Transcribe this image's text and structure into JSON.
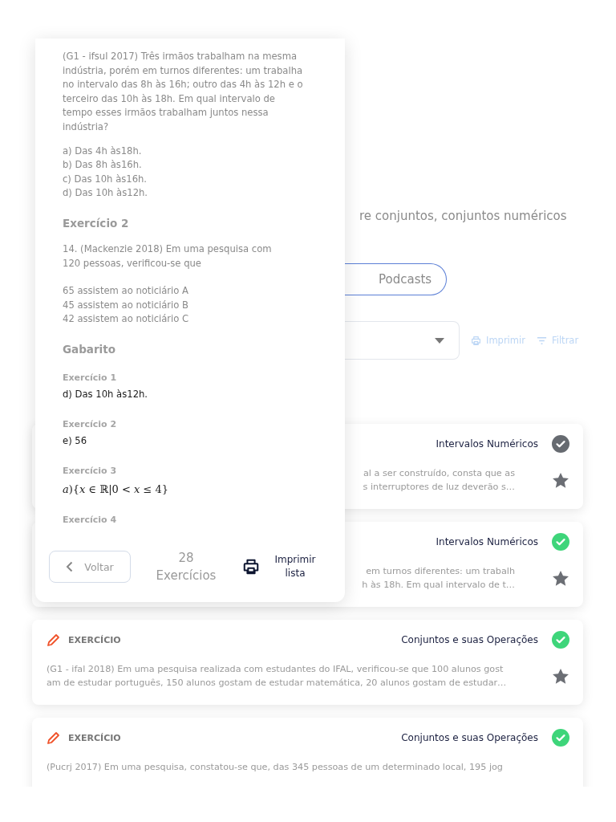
{
  "page": {
    "intro": "re conjuntos, conjuntos numéricos",
    "pill": "Podcasts",
    "actions": [
      {
        "kind": "print",
        "label": "Imprimir"
      },
      {
        "kind": "filter",
        "label": "Filtrar"
      }
    ],
    "cards": [
      {
        "topic": "Intervalos Numéricos",
        "solved": false,
        "lines": [
          "al a ser construído, consta que as",
          "s interruptores de luz deverão s…"
        ]
      },
      {
        "topic": "Intervalos Numéricos",
        "solved": true,
        "lines": [
          "em turnos diferentes: um trabalh",
          "h às 18h. Em qual intervalo de t…"
        ]
      },
      {
        "label": "EXERCÍCIO",
        "topic": "Conjuntos e suas Operações",
        "solved": true,
        "lines": [
          "(G1 - ifal 2018)  Em uma pesquisa realizada com estudantes do IFAL, verificou-se que 100 alunos gost",
          "am de estudar português, 150 alunos gostam de estudar matemática, 20 alunos gostam de estudar…"
        ]
      },
      {
        "label": "EXERCÍCIO",
        "topic": "Conjuntos e suas Operações",
        "solved": true,
        "lines": [
          "(Pucrj 2017)  Em uma pesquisa, constatou-se que, das 345 pessoas de um determinado local, 195 jog"
        ]
      }
    ]
  },
  "modal": {
    "blocks": [
      {
        "kind": "paragraph",
        "text": "(G1 - ifsul 2017) Três irmãos trabalham na mesma indústria, porém em turnos diferentes: um trabalha no intervalo das 8h às 16h; outro das 4h às 12h e o terceiro das 10h às 18h. Em qual intervalo de tempo esses irmãos trabalham juntos nessa indústria?"
      },
      {
        "kind": "lines",
        "items": [
          "a) Das 4h às18h.",
          "b) Das 8h às16h.",
          "c) Das 10h às16h.",
          "d) Das 10h às12h."
        ]
      },
      {
        "kind": "heading",
        "text": "Exercício 2"
      },
      {
        "kind": "lines",
        "items": [
          "14. (Mackenzie 2018)  Em uma pesquisa com",
          "120 pessoas, verificou-se que"
        ]
      },
      {
        "kind": "lines",
        "items": [
          "65 assistem ao noticiário A",
          "45 assistem ao noticiário B",
          "42 assistem ao noticiário C"
        ]
      },
      {
        "kind": "heading",
        "text": "Gabarito"
      },
      {
        "kind": "answer_label",
        "text": "Exercício 1"
      },
      {
        "kind": "answer",
        "text": "d) Das 10h às12h."
      },
      {
        "kind": "answer_label",
        "text": "Exercício 2"
      },
      {
        "kind": "answer",
        "text": "e) 56"
      },
      {
        "kind": "answer_label",
        "text": "Exercício 3"
      },
      {
        "kind": "math",
        "text": "*a*){*x* ∈ ℝ|0 < *x* ≤ 4}"
      },
      {
        "kind": "answer_label",
        "text": "Exercício 4"
      }
    ],
    "back_button": "Voltar",
    "count": "28",
    "count_label": "Exercícios",
    "print_button": "Imprimir lista"
  }
}
